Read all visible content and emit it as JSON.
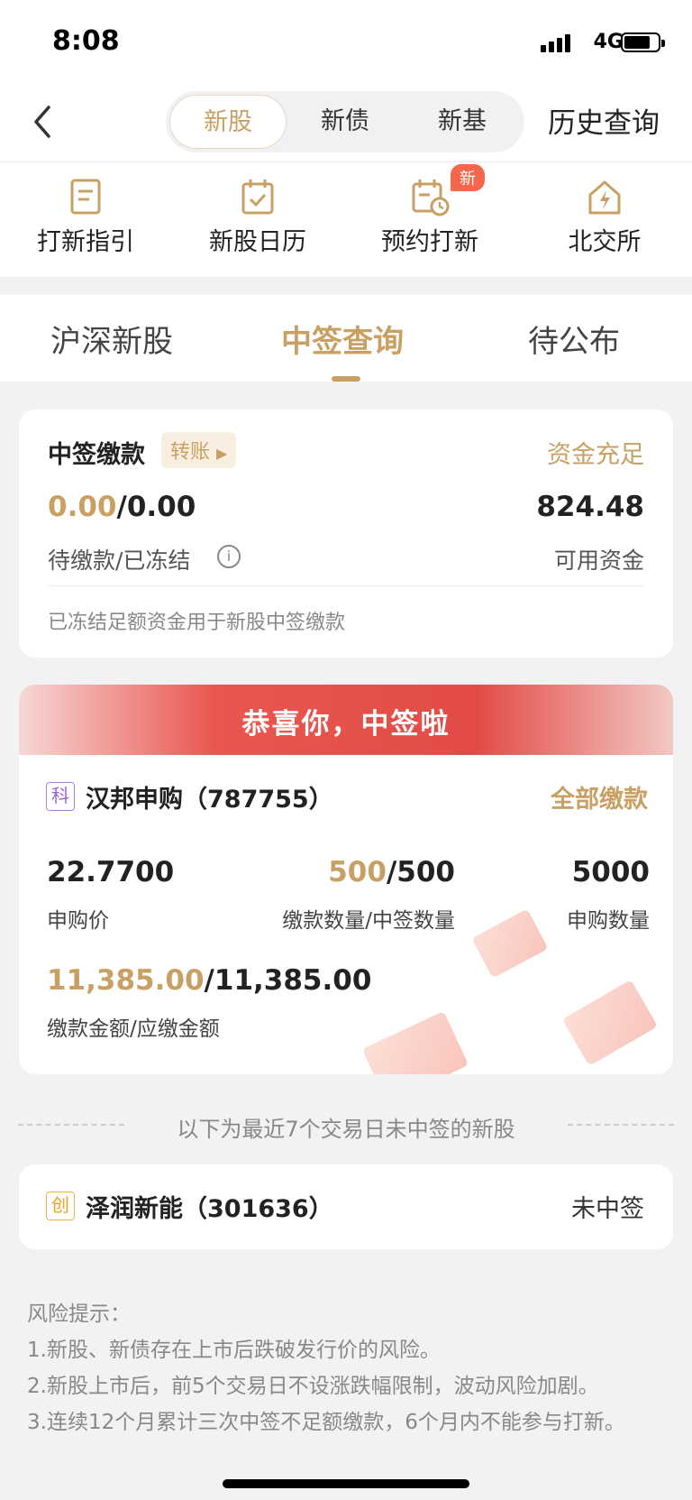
{
  "status": {
    "time": "8:08",
    "network": "4G"
  },
  "nav": {
    "segments": [
      "新股",
      "新债",
      "新基"
    ],
    "active_segment": "新股",
    "history": "历史查询"
  },
  "quick_menu": [
    {
      "label": "打新指引",
      "icon": "guide-icon"
    },
    {
      "label": "新股日历",
      "icon": "calendar-check-icon"
    },
    {
      "label": "预约打新",
      "icon": "calendar-clock-icon",
      "badge": "新"
    },
    {
      "label": "北交所",
      "icon": "house-icon"
    }
  ],
  "tabs": [
    "沪深新股",
    "中签查询",
    "待公布"
  ],
  "active_tab": "中签查询",
  "payment": {
    "title": "中签缴款",
    "transfer": "转账",
    "status": "资金充足",
    "pending": "0.00",
    "frozen": "/0.00",
    "available": "824.48",
    "pending_label": "待缴款/已冻结",
    "available_label": "可用资金",
    "note": "已冻结足额资金用于新股中签缴款"
  },
  "winning": {
    "banner": "恭喜你，中签啦",
    "board_tag": "科",
    "name": "汉邦申购（787755）",
    "pay_all": "全部缴款",
    "price": "22.7700",
    "price_label": "申购价",
    "paid_qty": "500",
    "won_qty": "/500",
    "qty_label": "缴款数量/中签数量",
    "sub_qty": "5000",
    "sub_qty_label": "申购数量",
    "paid_amount": "11,385.00",
    "due_amount": "/11,385.00",
    "amount_label": "缴款金额/应缴金额"
  },
  "separator": "以下为最近7个交易日未中签的新股",
  "not_won": {
    "board_tag": "创",
    "name": "泽润新能（301636）",
    "status": "未中签"
  },
  "risk": [
    "风险提示：",
    "1.新股、新债存在上市后跌破发行价的风险。",
    "2.新股上市后，前5个交易日不设涨跌幅限制，波动风险加剧。",
    "3.连续12个月累计三次中签不足额缴款，6个月内不能参与打新。"
  ]
}
